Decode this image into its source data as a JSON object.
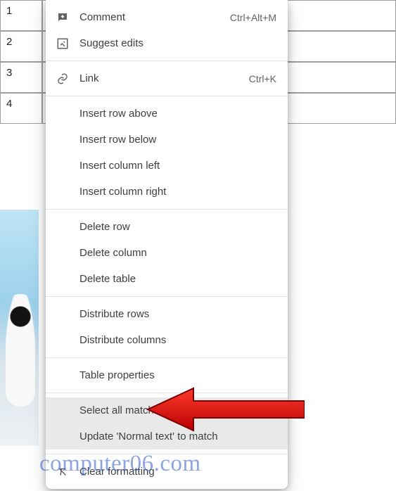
{
  "table": {
    "rows": [
      "1",
      "2",
      "3",
      "4"
    ]
  },
  "menu": {
    "comment": {
      "label": "Comment",
      "shortcut": "Ctrl+Alt+M"
    },
    "suggest": {
      "label": "Suggest edits"
    },
    "link": {
      "label": "Link",
      "shortcut": "Ctrl+K"
    },
    "insert_row_above": {
      "label": "Insert row above"
    },
    "insert_row_below": {
      "label": "Insert row below"
    },
    "insert_col_left": {
      "label": "Insert column left"
    },
    "insert_col_right": {
      "label": "Insert column right"
    },
    "delete_row": {
      "label": "Delete row"
    },
    "delete_column": {
      "label": "Delete column"
    },
    "delete_table": {
      "label": "Delete table"
    },
    "distribute_rows": {
      "label": "Distribute rows"
    },
    "distribute_columns": {
      "label": "Distribute columns"
    },
    "table_properties": {
      "label": "Table properties"
    },
    "select_matching": {
      "label": "Select all matching text"
    },
    "update_normal": {
      "label": "Update 'Normal text' to match"
    },
    "clear_formatting": {
      "label": "Clear formatting"
    }
  },
  "annotation": {
    "target": "table_properties",
    "color": "#d90000"
  },
  "watermark": "computer06.com"
}
